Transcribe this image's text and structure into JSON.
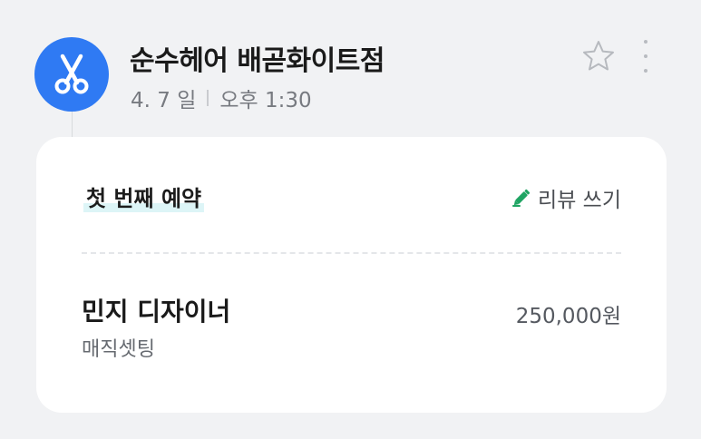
{
  "shop": {
    "name": "순수헤어 배곧화이트점",
    "icon": "scissors-icon"
  },
  "meta": {
    "date": "4. 7 일",
    "time": "오후 1:30"
  },
  "actions": {
    "favorite_icon": "star-icon",
    "more_icon": "more-vertical-icon"
  },
  "card": {
    "title": "첫 번째 예약",
    "review_label": "리뷰 쓰기",
    "review_icon": "pencil-icon",
    "designer": "민지 디자이너",
    "service": "매직셋팅",
    "price": "250,000원"
  },
  "colors": {
    "avatar_bg": "#2f7af3",
    "accent_green": "#1fa463",
    "highlight": "#ddf5f7"
  }
}
